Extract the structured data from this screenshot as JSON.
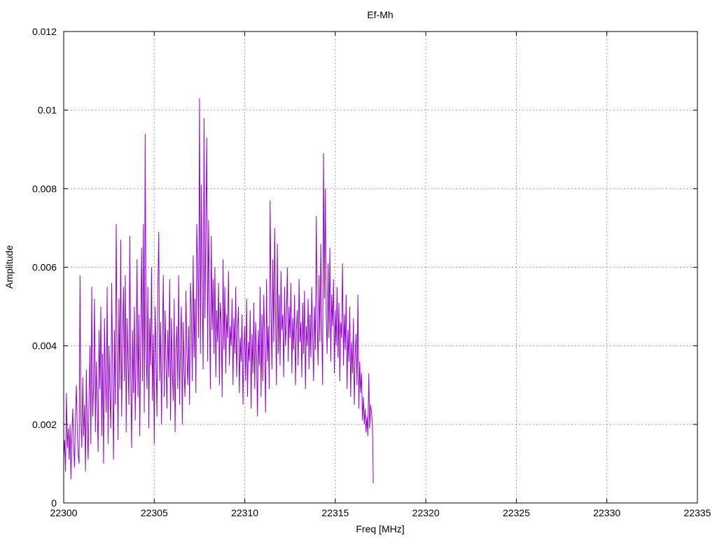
{
  "chart_data": {
    "type": "line",
    "title": "Ef-Mh",
    "xlabel": "Freq [MHz]",
    "ylabel": "Amplitude",
    "xlim": [
      22300,
      22335
    ],
    "ylim": [
      0,
      0.012
    ],
    "x_ticks": [
      "22300",
      "22305",
      "22310",
      "22315",
      "22320",
      "22325",
      "22330",
      "22335"
    ],
    "y_ticks": [
      "0",
      "0.002",
      "0.004",
      "0.006",
      "0.008",
      "0.01",
      "0.012"
    ],
    "grid": true,
    "legend": "none",
    "series_color": "#9400d3",
    "x_start": 22300,
    "x_step": 0.05,
    "series": [
      {
        "values": [
          0.0012,
          0.0016,
          0.0008,
          0.0028,
          0.0014,
          0.0019,
          0.0011,
          0.002,
          0.0006,
          0.0017,
          0.0024,
          0.0015,
          0.0009,
          0.0022,
          0.003,
          0.0018,
          0.0012,
          0.001,
          0.0058,
          0.0021,
          0.0014,
          0.0032,
          0.0017,
          0.0025,
          0.0008,
          0.0034,
          0.0019,
          0.0011,
          0.0027,
          0.004,
          0.0015,
          0.0055,
          0.0022,
          0.003,
          0.0052,
          0.0018,
          0.0036,
          0.0025,
          0.0013,
          0.0044,
          0.0029,
          0.005,
          0.0017,
          0.0038,
          0.001,
          0.0047,
          0.0032,
          0.0023,
          0.0055,
          0.0015,
          0.004,
          0.0028,
          0.0019,
          0.0056,
          0.0034,
          0.0011,
          0.0044,
          0.0025,
          0.0071,
          0.0038,
          0.0016,
          0.0052,
          0.0029,
          0.0067,
          0.0022,
          0.0041,
          0.0055,
          0.0031,
          0.0058,
          0.0018,
          0.0047,
          0.0036,
          0.0025,
          0.0068,
          0.0033,
          0.0014,
          0.0044,
          0.0028,
          0.005,
          0.0021,
          0.0038,
          0.0062,
          0.0027,
          0.0048,
          0.0017,
          0.0042,
          0.0065,
          0.0031,
          0.0071,
          0.0023,
          0.0094,
          0.004,
          0.0029,
          0.0055,
          0.0019,
          0.0047,
          0.0035,
          0.006,
          0.0026,
          0.0043,
          0.0015,
          0.005,
          0.0037,
          0.0022,
          0.0055,
          0.0069,
          0.0031,
          0.0046,
          0.002,
          0.0041,
          0.0058,
          0.0027,
          0.0049,
          0.0036,
          0.0024,
          0.0044,
          0.0032,
          0.0057,
          0.0021,
          0.0047,
          0.0034,
          0.0026,
          0.0052,
          0.0018,
          0.0039,
          0.0045,
          0.0029,
          0.0058,
          0.0025,
          0.0041,
          0.005,
          0.002,
          0.0046,
          0.0033,
          0.0027,
          0.0054,
          0.0038,
          0.003,
          0.0045,
          0.0025,
          0.0056,
          0.0049,
          0.0031,
          0.0063,
          0.0037,
          0.0052,
          0.0028,
          0.0071,
          0.006,
          0.0042,
          0.0103,
          0.0038,
          0.0081,
          0.0055,
          0.0034,
          0.0098,
          0.0047,
          0.007,
          0.0093,
          0.0036,
          0.0072,
          0.0052,
          0.0029,
          0.0068,
          0.0044,
          0.0057,
          0.0038,
          0.006,
          0.0032,
          0.0049,
          0.0041,
          0.0056,
          0.003,
          0.0051,
          0.0046,
          0.0027,
          0.0062,
          0.0039,
          0.0055,
          0.0033,
          0.0048,
          0.0042,
          0.0059,
          0.0035,
          0.0045,
          0.004,
          0.0052,
          0.003,
          0.0047,
          0.0038,
          0.0055,
          0.0032,
          0.0044,
          0.005,
          0.0028,
          0.0042,
          0.0036,
          0.0048,
          0.0025,
          0.0039,
          0.0045,
          0.0031,
          0.0052,
          0.0027,
          0.0041,
          0.0036,
          0.0049,
          0.0024,
          0.0043,
          0.0033,
          0.0051,
          0.0029,
          0.0046,
          0.0038,
          0.0022,
          0.0044,
          0.0035,
          0.0055,
          0.0027,
          0.0048,
          0.0031,
          0.0053,
          0.004,
          0.0023,
          0.0057,
          0.0036,
          0.0045,
          0.0029,
          0.0077,
          0.005,
          0.0034,
          0.0062,
          0.0041,
          0.007,
          0.0047,
          0.003,
          0.0066,
          0.0038,
          0.0053,
          0.0035,
          0.0059,
          0.0044,
          0.0048,
          0.0032,
          0.0055,
          0.004,
          0.0046,
          0.006,
          0.0036,
          0.005,
          0.0042,
          0.0056,
          0.0033,
          0.0047,
          0.0039,
          0.0053,
          0.003,
          0.0044,
          0.0049,
          0.0035,
          0.0057,
          0.0041,
          0.0046,
          0.0032,
          0.0051,
          0.0038,
          0.0054,
          0.0029,
          0.0045,
          0.004,
          0.0052,
          0.0034,
          0.0048,
          0.0037,
          0.0055,
          0.0043,
          0.0031,
          0.005,
          0.0039,
          0.0073,
          0.0046,
          0.0035,
          0.0058,
          0.0041,
          0.0066,
          0.0044,
          0.003,
          0.0089,
          0.0052,
          0.008,
          0.0047,
          0.0038,
          0.0061,
          0.0042,
          0.0065,
          0.0036,
          0.0053,
          0.0045,
          0.0057,
          0.0033,
          0.0049,
          0.004,
          0.0055,
          0.0037,
          0.0051,
          0.0031,
          0.0046,
          0.0042,
          0.0061,
          0.0035,
          0.0048,
          0.0039,
          0.0053,
          0.0029,
          0.0044,
          0.0036,
          0.005,
          0.0027,
          0.0041,
          0.0033,
          0.0047,
          0.0025,
          0.0038,
          0.0043,
          0.003,
          0.0053,
          0.0024,
          0.0036,
          0.0028,
          0.0033,
          0.0021,
          0.0027,
          0.002,
          0.0024,
          0.0018,
          0.0022,
          0.0017,
          0.0033,
          0.0019,
          0.0025,
          0.0023,
          0.002,
          0.0005
        ]
      }
    ]
  }
}
